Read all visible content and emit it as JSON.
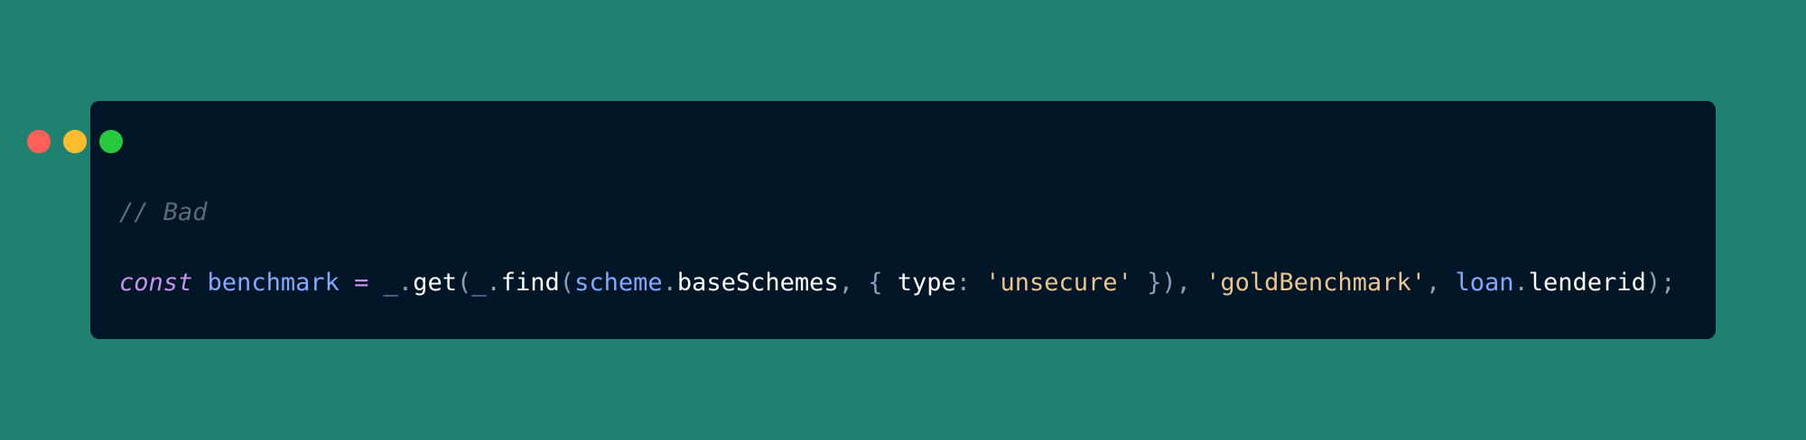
{
  "colors": {
    "background": "#1f8270",
    "window": "#001526",
    "dot_red": "#ff5f56",
    "dot_yellow": "#ffbd2e",
    "dot_green": "#27c93f"
  },
  "window": {
    "controls": [
      {
        "name": "close",
        "color": "#ff5f56"
      },
      {
        "name": "minimize",
        "color": "#ffbd2e"
      },
      {
        "name": "maximize",
        "color": "#27c93f"
      }
    ]
  },
  "code": {
    "comment": "// Bad",
    "tokens": {
      "t1": "const",
      "t2": " ",
      "t3": "benchmark",
      "t4": " ",
      "t5": "=",
      "t6": " ",
      "t7": "_",
      "t8": ".",
      "t9": "get",
      "t10": "(",
      "t11": "_",
      "t12": ".",
      "t13": "find",
      "t14": "(",
      "t15": "scheme",
      "t16": ".",
      "t17": "baseSchemes",
      "t18": ", ",
      "t19": "{ ",
      "t20": "type",
      "t21": ": ",
      "t22": "'unsecure'",
      "t23": " })",
      "t24": ", ",
      "t25": "'goldBenchmark'",
      "t26": ", ",
      "t27": "loan",
      "t28": ".",
      "t29": "lenderid",
      "t30": ");"
    }
  }
}
